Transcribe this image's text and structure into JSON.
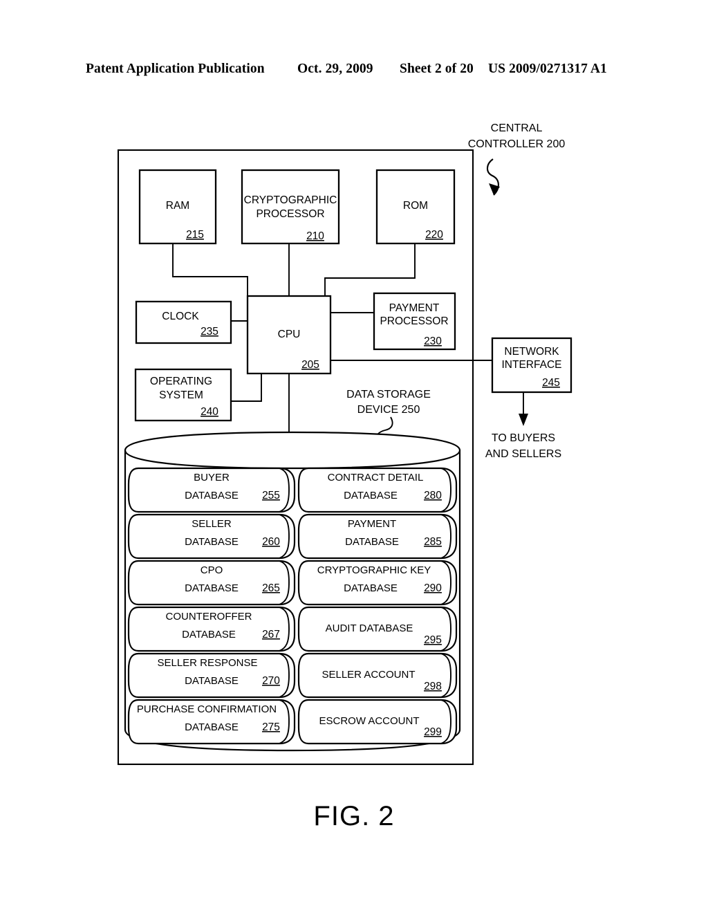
{
  "header": {
    "publication": "Patent Application Publication",
    "date": "Oct. 29, 2009",
    "sheet": "Sheet 2 of 20",
    "number": "US 2009/0271317 A1"
  },
  "figure": {
    "caption": "FIG. 2",
    "title_callout": {
      "line1": "CENTRAL",
      "line2": "CONTROLLER 200"
    },
    "storage_callout": {
      "line1": "DATA STORAGE",
      "line2": "DEVICE 250"
    },
    "network_callout": {
      "line1": "TO BUYERS",
      "line2": "AND SELLERS"
    }
  },
  "blocks": [
    {
      "id": "ram",
      "lines": [
        "RAM"
      ],
      "ref": "215"
    },
    {
      "id": "crypto",
      "lines": [
        "CRYPTOGRAPHIC",
        "PROCESSOR"
      ],
      "ref": "210"
    },
    {
      "id": "rom",
      "lines": [
        "ROM"
      ],
      "ref": "220"
    },
    {
      "id": "clock",
      "lines": [
        "CLOCK"
      ],
      "ref": "235"
    },
    {
      "id": "cpu",
      "lines": [
        "CPU"
      ],
      "ref": "205"
    },
    {
      "id": "payment",
      "lines": [
        "PAYMENT",
        "PROCESSOR"
      ],
      "ref": "230"
    },
    {
      "id": "os",
      "lines": [
        "OPERATING",
        "SYSTEM"
      ],
      "ref": "240"
    },
    {
      "id": "network",
      "lines": [
        "NETWORK",
        "INTERFACE"
      ],
      "ref": "245"
    }
  ],
  "databases_left": [
    {
      "id": "buyer",
      "lines": [
        "BUYER",
        "DATABASE"
      ],
      "ref": "255"
    },
    {
      "id": "seller",
      "lines": [
        "SELLER",
        "DATABASE"
      ],
      "ref": "260"
    },
    {
      "id": "cpo",
      "lines": [
        "CPO",
        "DATABASE"
      ],
      "ref": "265"
    },
    {
      "id": "counteroffer",
      "lines": [
        "COUNTEROFFER",
        "DATABASE"
      ],
      "ref": "267"
    },
    {
      "id": "sellerresp",
      "lines": [
        "SELLER RESPONSE",
        "DATABASE"
      ],
      "ref": "270"
    },
    {
      "id": "purchconf",
      "lines": [
        "PURCHASE CONFIRMATION",
        "DATABASE"
      ],
      "ref": "275"
    }
  ],
  "databases_right": [
    {
      "id": "contract",
      "lines": [
        "CONTRACT DETAIL",
        "DATABASE"
      ],
      "ref": "280"
    },
    {
      "id": "paymentdb",
      "lines": [
        "PAYMENT",
        "DATABASE"
      ],
      "ref": "285"
    },
    {
      "id": "cryptokey",
      "lines": [
        "CRYPTOGRAPHIC KEY",
        "DATABASE"
      ],
      "ref": "290"
    },
    {
      "id": "audit",
      "lines": [
        "AUDIT DATABASE"
      ],
      "ref": "295"
    },
    {
      "id": "selleracct",
      "lines": [
        "SELLER ACCOUNT"
      ],
      "ref": "298"
    },
    {
      "id": "escrowacct",
      "lines": [
        "ESCROW ACCOUNT"
      ],
      "ref": "299"
    }
  ]
}
